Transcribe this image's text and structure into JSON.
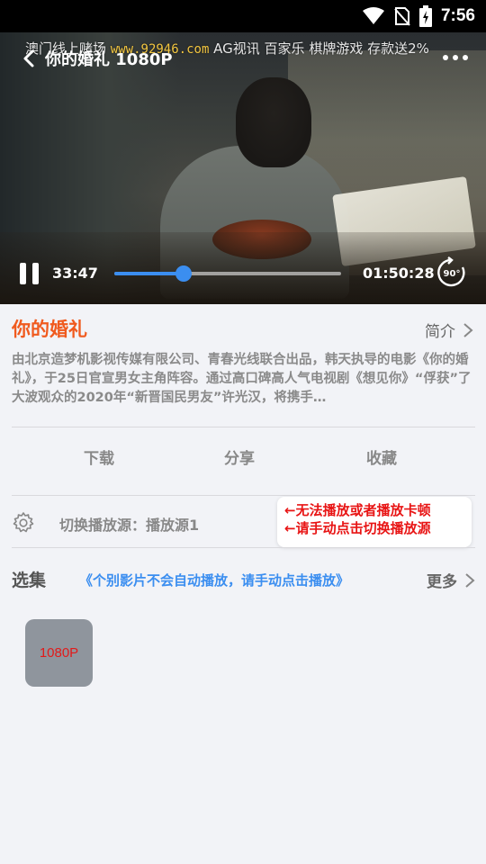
{
  "status_bar": {
    "time": "7:56",
    "icons": [
      "wifi-icon",
      "no-sim-icon",
      "battery-charging-icon"
    ]
  },
  "player": {
    "marquee_before": "澳门线上赌场",
    "marquee_url": "www.92946.com",
    "marquee_after": "AG视讯 百家乐 棋牌游戏 存款送2%",
    "title": "你的婚礼 1080P",
    "current_time": "33:47",
    "total_time": "01:50:28",
    "progress_fraction": 0.305,
    "rotate_label": "90°"
  },
  "movie": {
    "title": "你的婚礼",
    "intro_label": "简介",
    "description": "由北京造梦机影视传媒有限公司、青春光线联合出品，韩天执导的电影《你的婚礼》，于25日官宣男女主角阵容。通过高口碑高人气电视剧《想见你》“俘获”了大波观众的2020年“新晋国民男友”许光汉，将携手…"
  },
  "actions": {
    "download": "下载",
    "share": "分享",
    "favorite": "收藏"
  },
  "source": {
    "label": "切换播放源：播放源1",
    "tip_line1": "←无法播放或者播放卡顿",
    "tip_line2": "←请手动点击切换播放源"
  },
  "episodes": {
    "title": "选集",
    "note": "《个别影片不会自动播放，请手动点击播放》",
    "more_label": "更多",
    "items": [
      "1080P"
    ]
  },
  "colors": {
    "accent_orange": "#f05a1e",
    "accent_blue": "#3b8ef0",
    "tip_red": "#e81414"
  }
}
